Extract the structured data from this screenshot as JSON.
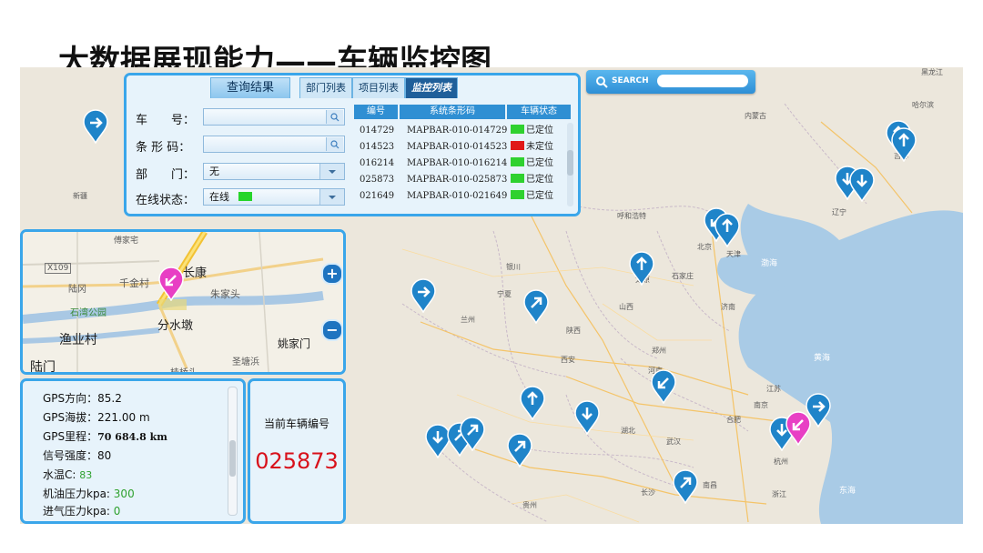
{
  "page_title": "大数据展现能力——车辆监控图",
  "search": {
    "label": "SEARCH",
    "value": ""
  },
  "query_panel": {
    "tabs": [
      "查询结果",
      "部门列表",
      "项目列表",
      "监控列表"
    ],
    "fields": [
      {
        "label": "车　　号：",
        "value": ""
      },
      {
        "label": "条 形 码：",
        "value": ""
      },
      {
        "label": "部　　门：",
        "value": "无"
      },
      {
        "label": "在线状态：",
        "value": "在线"
      }
    ],
    "online_color": "#26d52a",
    "table": {
      "headers": [
        "编号",
        "系统条形码",
        "车辆状态"
      ],
      "rows": [
        {
          "id": "014729",
          "code": "MAPBAR-010-014729",
          "status": "已定位",
          "color": "#2fd12f"
        },
        {
          "id": "014523",
          "code": "MAPBAR-010-014523",
          "status": "未定位",
          "color": "#e01818"
        },
        {
          "id": "016214",
          "code": "MAPBAR-010-016214",
          "status": "已定位",
          "color": "#2fd12f"
        },
        {
          "id": "025873",
          "code": "MAPBAR-010-025873",
          "status": "已定位",
          "color": "#2fd12f"
        },
        {
          "id": "021649",
          "code": "MAPBAR-010-021649",
          "status": "已定位",
          "color": "#2fd12f"
        }
      ]
    }
  },
  "mini_map": {
    "labels": [
      "傅家宅",
      "X109",
      "千金村",
      "长康",
      "陆冈",
      "朱家头",
      "石湾公园",
      "分水墩",
      "渔业村",
      "姚家门",
      "陆门",
      "桂桥头",
      "圣塘浜"
    ],
    "zoom_in": "+",
    "zoom_out": "−"
  },
  "vehicle_info": {
    "lines": [
      {
        "label": "GPS方向：",
        "value": "85.2"
      },
      {
        "label": "GPS海拔：",
        "value": "221.00 m"
      },
      {
        "label": "GPS里程：",
        "value": "70 684.8 km"
      },
      {
        "label": "信号强度：",
        "value": "80"
      },
      {
        "label": "水温C:",
        "value": "83"
      },
      {
        "label": "机油压力kpa:",
        "value": "300"
      },
      {
        "label": "进气压力kpa:",
        "value": "0"
      }
    ]
  },
  "current_vehicle": {
    "label": "当前车辆编号",
    "number": "025873"
  },
  "map_labels": [
    "黑龙江",
    "哈尔滨",
    "内蒙古",
    "吉林",
    "新疆",
    "辽宁",
    "呼和浩特",
    "北京",
    "天津",
    "渤海",
    "银川",
    "太原",
    "石家庄",
    "宁夏",
    "兰州",
    "济南",
    "山西",
    "陕西",
    "郑州",
    "西安",
    "黄海",
    "河南",
    "江苏",
    "南京",
    "合肥",
    "湖北",
    "武汉",
    "杭州",
    "长沙",
    "南昌",
    "浙江",
    "东海",
    "贵州"
  ],
  "colors": {
    "accent": "#3aa6ea",
    "pin_blue": "#1f84c9",
    "pin_pink": "#e83fc4",
    "current_number": "#d8111b"
  }
}
